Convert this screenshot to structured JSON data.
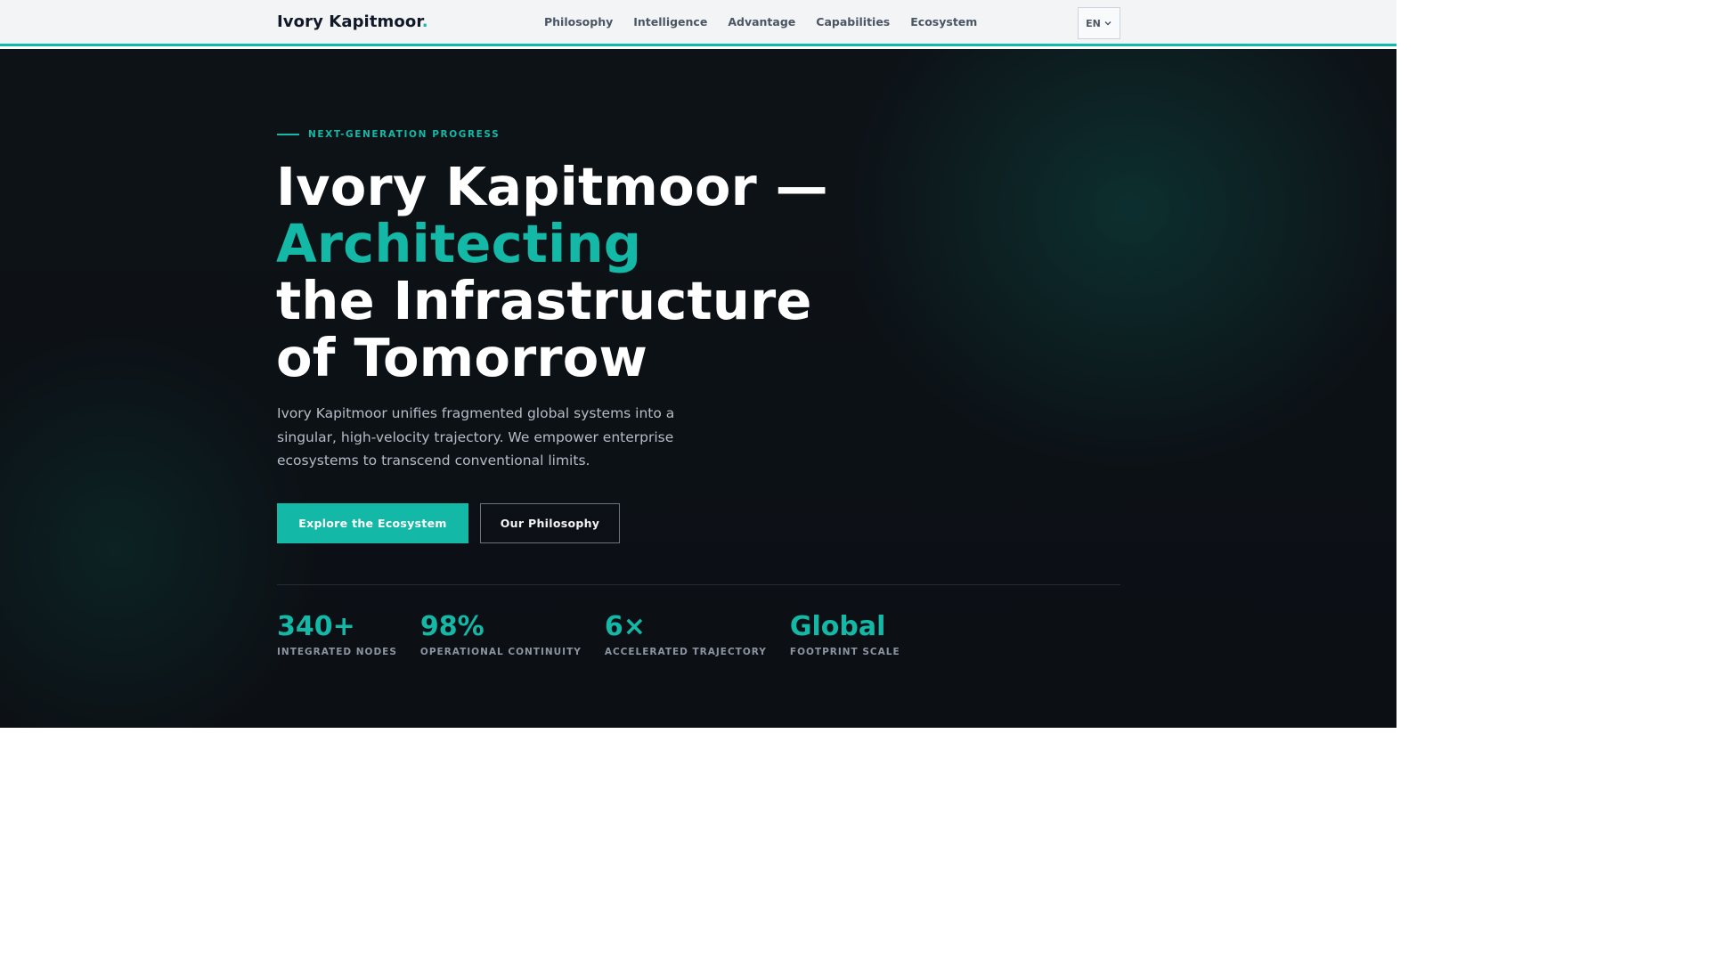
{
  "nav": {
    "brand": "Ivory Kapitmoor",
    "brand_dot": ".",
    "links": [
      "Philosophy",
      "Intelligence",
      "Advantage",
      "Capabilities",
      "Ecosystem"
    ],
    "language": "EN",
    "language_icon": "chevron-down-icon"
  },
  "hero": {
    "eyebrow": "NEXT-GENERATION PROGRESS",
    "headline": {
      "line1": "Ivory Kapitmoor —",
      "line2": "Architecting",
      "line3": "the Infrastructure",
      "line4": "of Tomorrow"
    },
    "description": "Ivory Kapitmoor unifies fragmented global systems into a singular, high-velocity trajectory. We empower enterprise ecosystems to transcend conventional limits.",
    "primary_cta": "Explore the Ecosystem",
    "secondary_cta": "Our Philosophy"
  },
  "stats": [
    {
      "value": "340+",
      "label": "INTEGRATED NODES"
    },
    {
      "value": "98%",
      "label": "OPERATIONAL CONTINUITY"
    },
    {
      "value": "6×",
      "label": "ACCELERATED TRAJECTORY"
    },
    {
      "value": "Global",
      "label": "FOOTPRINT SCALE"
    }
  ],
  "colors": {
    "accent": "#14b8a6",
    "hero_background": "#0d1217",
    "nav_background": "#f3f4f6"
  }
}
